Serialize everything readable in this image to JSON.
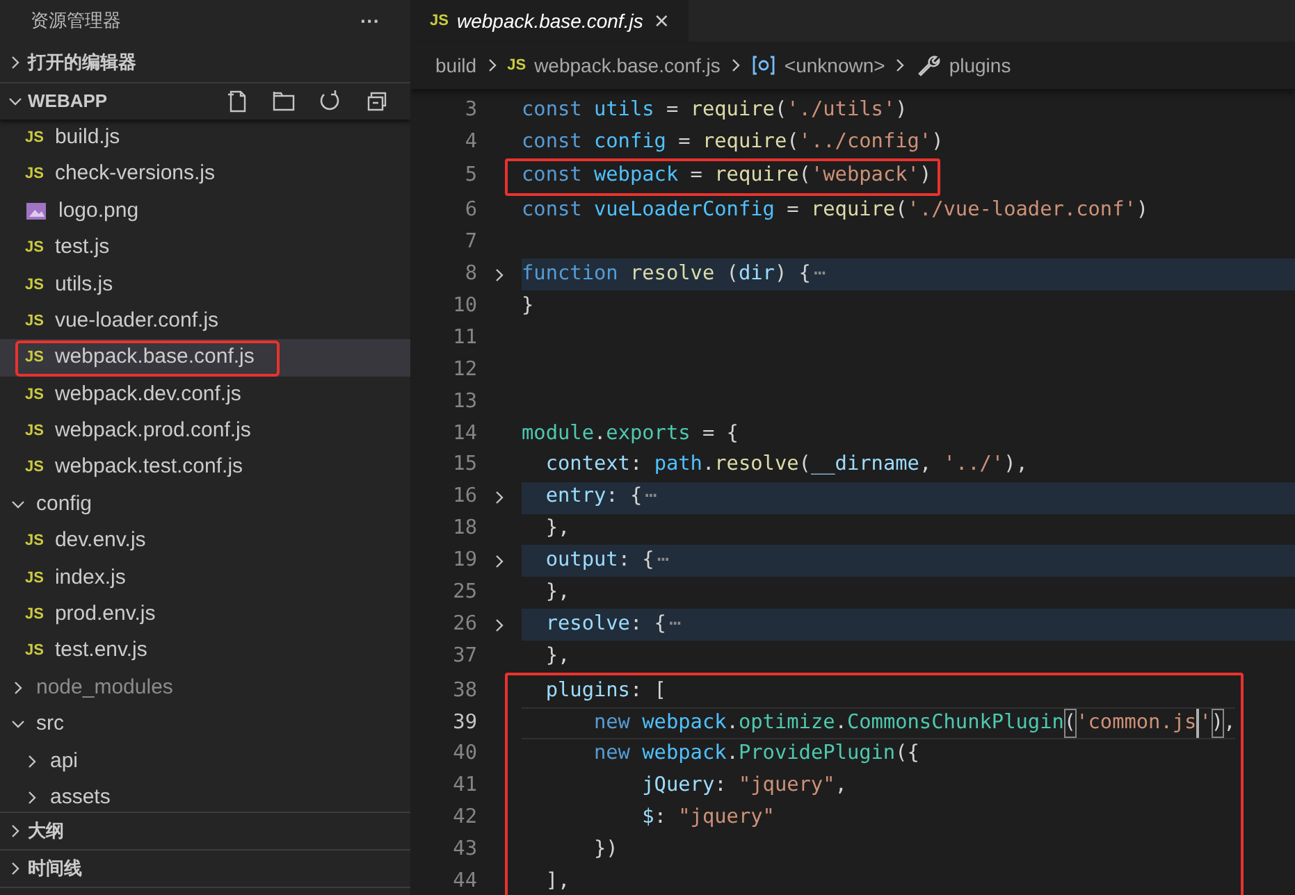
{
  "sidebar": {
    "title": "资源管理器",
    "more": "···",
    "sections": [
      {
        "label": "打开的编辑器",
        "expanded": false
      }
    ],
    "project": {
      "label": "WEBAPP",
      "expanded": true
    },
    "tree": [
      {
        "kind": "continued",
        "children": [
          {
            "kind": "js",
            "badge": "JS",
            "label": "build.js",
            "selected": false,
            "annotated": false
          },
          {
            "kind": "js",
            "badge": "JS",
            "label": "check-versions.js",
            "selected": false,
            "annotated": false
          },
          {
            "kind": "image",
            "label": "logo.png",
            "selected": false,
            "annotated": false
          },
          {
            "kind": "js",
            "badge": "JS",
            "label": "test.js",
            "selected": false,
            "annotated": false
          },
          {
            "kind": "js",
            "badge": "JS",
            "label": "utils.js",
            "selected": false,
            "annotated": false
          },
          {
            "kind": "js",
            "badge": "JS",
            "label": "vue-loader.conf.js",
            "selected": false,
            "annotated": false
          },
          {
            "kind": "js",
            "badge": "JS",
            "label": "webpack.base.conf.js",
            "selected": true,
            "annotated": true
          },
          {
            "kind": "js",
            "badge": "JS",
            "label": "webpack.dev.conf.js",
            "selected": false,
            "annotated": false
          },
          {
            "kind": "js",
            "badge": "JS",
            "label": "webpack.prod.conf.js",
            "selected": false,
            "annotated": false
          },
          {
            "kind": "js",
            "badge": "JS",
            "label": "webpack.test.conf.js",
            "selected": false,
            "annotated": false
          }
        ]
      },
      {
        "kind": "folder",
        "label": "config",
        "expanded": true,
        "dimmed": false,
        "children": [
          {
            "kind": "js",
            "badge": "JS",
            "label": "dev.env.js",
            "selected": false,
            "annotated": false
          },
          {
            "kind": "js",
            "badge": "JS",
            "label": "index.js",
            "selected": false,
            "annotated": false
          },
          {
            "kind": "js",
            "badge": "JS",
            "label": "prod.env.js",
            "selected": false,
            "annotated": false
          },
          {
            "kind": "js",
            "badge": "JS",
            "label": "test.env.js",
            "selected": false,
            "annotated": false
          }
        ]
      },
      {
        "kind": "folder",
        "label": "node_modules",
        "expanded": false,
        "dimmed": true
      },
      {
        "kind": "folder",
        "label": "src",
        "expanded": true,
        "dimmed": false,
        "children": [
          {
            "kind": "folder",
            "label": "api",
            "expanded": false,
            "dimmed": false
          },
          {
            "kind": "folder",
            "label": "assets",
            "expanded": false,
            "dimmed": false
          }
        ]
      }
    ],
    "panels": [
      {
        "label": "大纲",
        "expanded": false
      },
      {
        "label": "时间线",
        "expanded": false
      }
    ]
  },
  "editor": {
    "tab": {
      "badge": "JS",
      "title": "webpack.base.conf.js",
      "close": "×"
    },
    "breadcrumbs": [
      {
        "kind": "text",
        "label": "build"
      },
      {
        "kind": "js",
        "badge": "JS",
        "label": "webpack.base.conf.js"
      },
      {
        "kind": "symbol",
        "label": "<unknown>"
      },
      {
        "kind": "property",
        "label": "plugins"
      }
    ],
    "blocks": [
      {
        "boxed": false,
        "lines": [
          {
            "number": "3",
            "folded": false,
            "current": false,
            "tokens": [
              {
                "text": "const ",
                "kind": "keyword"
              },
              {
                "text": "utils",
                "kind": "const"
              },
              {
                "text": " = ",
                "kind": "plain"
              },
              {
                "text": "require",
                "kind": "function"
              },
              {
                "text": "(",
                "kind": "plain"
              },
              {
                "text": "'./utils'",
                "kind": "string"
              },
              {
                "text": ")",
                "kind": "plain"
              }
            ]
          },
          {
            "number": "4",
            "folded": false,
            "current": false,
            "tokens": [
              {
                "text": "const ",
                "kind": "keyword"
              },
              {
                "text": "config",
                "kind": "const"
              },
              {
                "text": " = ",
                "kind": "plain"
              },
              {
                "text": "require",
                "kind": "function"
              },
              {
                "text": "(",
                "kind": "plain"
              },
              {
                "text": "'../config'",
                "kind": "string"
              },
              {
                "text": ")",
                "kind": "plain"
              }
            ]
          }
        ]
      },
      {
        "boxed": true,
        "lines": [
          {
            "number": "5",
            "folded": false,
            "current": false,
            "tokens": [
              {
                "text": "const ",
                "kind": "keyword"
              },
              {
                "text": "webpack",
                "kind": "const"
              },
              {
                "text": " = ",
                "kind": "plain"
              },
              {
                "text": "require",
                "kind": "function"
              },
              {
                "text": "(",
                "kind": "plain"
              },
              {
                "text": "'webpack'",
                "kind": "string"
              },
              {
                "text": ")",
                "kind": "plain"
              }
            ]
          }
        ]
      },
      {
        "boxed": false,
        "lines": [
          {
            "number": "6",
            "folded": false,
            "current": false,
            "tokens": [
              {
                "text": "const ",
                "kind": "keyword"
              },
              {
                "text": "vueLoaderConfig",
                "kind": "const"
              },
              {
                "text": " = ",
                "kind": "plain"
              },
              {
                "text": "require",
                "kind": "function"
              },
              {
                "text": "(",
                "kind": "plain"
              },
              {
                "text": "'./vue-loader.conf'",
                "kind": "string"
              },
              {
                "text": ")",
                "kind": "plain"
              }
            ]
          },
          {
            "number": "7",
            "folded": false,
            "current": false
          },
          {
            "number": "8",
            "folded": true,
            "current": false,
            "tokens": [
              {
                "text": "function ",
                "kind": "keyword"
              },
              {
                "text": "resolve",
                "kind": "function"
              },
              {
                "text": " (",
                "kind": "plain"
              },
              {
                "text": "dir",
                "kind": "property"
              },
              {
                "text": ") {",
                "kind": "plain"
              },
              {
                "text": "⋯",
                "kind": "fold"
              }
            ]
          },
          {
            "number": "10",
            "folded": false,
            "current": false,
            "tokens": [
              {
                "text": "}",
                "kind": "plain"
              }
            ]
          },
          {
            "number": "11",
            "folded": false,
            "current": false
          },
          {
            "number": "12",
            "folded": false,
            "current": false
          },
          {
            "number": "13",
            "folded": false,
            "current": false
          },
          {
            "number": "14",
            "folded": false,
            "current": false,
            "tokens": [
              {
                "text": "module",
                "kind": "class"
              },
              {
                "text": ".",
                "kind": "plain"
              },
              {
                "text": "exports",
                "kind": "class"
              },
              {
                "text": " = {",
                "kind": "plain"
              }
            ]
          },
          {
            "number": "15",
            "folded": false,
            "current": false,
            "tokens": [
              {
                "text": "  context",
                "kind": "property"
              },
              {
                "text": ": ",
                "kind": "plain"
              },
              {
                "text": "path",
                "kind": "const"
              },
              {
                "text": ".",
                "kind": "plain"
              },
              {
                "text": "resolve",
                "kind": "function"
              },
              {
                "text": "(",
                "kind": "plain"
              },
              {
                "text": "__dirname",
                "kind": "property"
              },
              {
                "text": ", ",
                "kind": "plain"
              },
              {
                "text": "'../'",
                "kind": "string"
              },
              {
                "text": "),",
                "kind": "plain"
              }
            ]
          },
          {
            "number": "16",
            "folded": true,
            "current": false,
            "tokens": [
              {
                "text": "  entry",
                "kind": "property"
              },
              {
                "text": ": {",
                "kind": "plain"
              },
              {
                "text": "⋯",
                "kind": "fold"
              }
            ]
          },
          {
            "number": "18",
            "folded": false,
            "current": false,
            "tokens": [
              {
                "text": "  },",
                "kind": "plain"
              }
            ]
          },
          {
            "number": "19",
            "folded": true,
            "current": false,
            "tokens": [
              {
                "text": "  output",
                "kind": "property"
              },
              {
                "text": ": {",
                "kind": "plain"
              },
              {
                "text": "⋯",
                "kind": "fold"
              }
            ]
          },
          {
            "number": "25",
            "folded": false,
            "current": false,
            "tokens": [
              {
                "text": "  },",
                "kind": "plain"
              }
            ]
          },
          {
            "number": "26",
            "folded": true,
            "current": false,
            "tokens": [
              {
                "text": "  resolve",
                "kind": "property"
              },
              {
                "text": ": {",
                "kind": "plain"
              },
              {
                "text": "⋯",
                "kind": "fold"
              }
            ]
          },
          {
            "number": "37",
            "folded": false,
            "current": false,
            "tokens": [
              {
                "text": "  },",
                "kind": "plain"
              }
            ]
          }
        ]
      },
      {
        "boxed": true,
        "lines": [
          {
            "number": "38",
            "folded": false,
            "current": false,
            "tokens": [
              {
                "text": "  plugins",
                "kind": "property"
              },
              {
                "text": ": [",
                "kind": "plain"
              }
            ]
          },
          {
            "number": "39",
            "folded": false,
            "current": true,
            "tokens": [
              {
                "text": "      new ",
                "kind": "keyword"
              },
              {
                "text": "webpack",
                "kind": "const"
              },
              {
                "text": ".",
                "kind": "plain"
              },
              {
                "text": "optimize",
                "kind": "class"
              },
              {
                "text": ".",
                "kind": "plain"
              },
              {
                "text": "CommonsChunkPlugin",
                "kind": "class"
              },
              {
                "text": "(",
                "kind": "bracket-match"
              },
              {
                "text": "'common.js",
                "kind": "string-caret"
              },
              {
                "text": "'",
                "kind": "string"
              },
              {
                "text": ")",
                "kind": "bracket-match"
              },
              {
                "text": ",",
                "kind": "plain"
              }
            ]
          },
          {
            "number": "40",
            "folded": false,
            "current": false,
            "tokens": [
              {
                "text": "      new ",
                "kind": "keyword"
              },
              {
                "text": "webpack",
                "kind": "const"
              },
              {
                "text": ".",
                "kind": "plain"
              },
              {
                "text": "ProvidePlugin",
                "kind": "class"
              },
              {
                "text": "({",
                "kind": "plain"
              }
            ]
          },
          {
            "number": "41",
            "folded": false,
            "current": false,
            "tokens": [
              {
                "text": "          jQuery",
                "kind": "property"
              },
              {
                "text": ": ",
                "kind": "plain"
              },
              {
                "text": "\"jquery\"",
                "kind": "string"
              },
              {
                "text": ",",
                "kind": "plain"
              }
            ]
          },
          {
            "number": "42",
            "folded": false,
            "current": false,
            "tokens": [
              {
                "text": "          $",
                "kind": "property"
              },
              {
                "text": ": ",
                "kind": "plain"
              },
              {
                "text": "\"jquery\"",
                "kind": "string"
              }
            ]
          },
          {
            "number": "43",
            "folded": false,
            "current": false,
            "tokens": [
              {
                "text": "      })",
                "kind": "plain"
              }
            ]
          },
          {
            "number": "44",
            "folded": false,
            "current": false,
            "tokens": [
              {
                "text": "  ],",
                "kind": "plain"
              }
            ]
          }
        ]
      }
    ]
  }
}
